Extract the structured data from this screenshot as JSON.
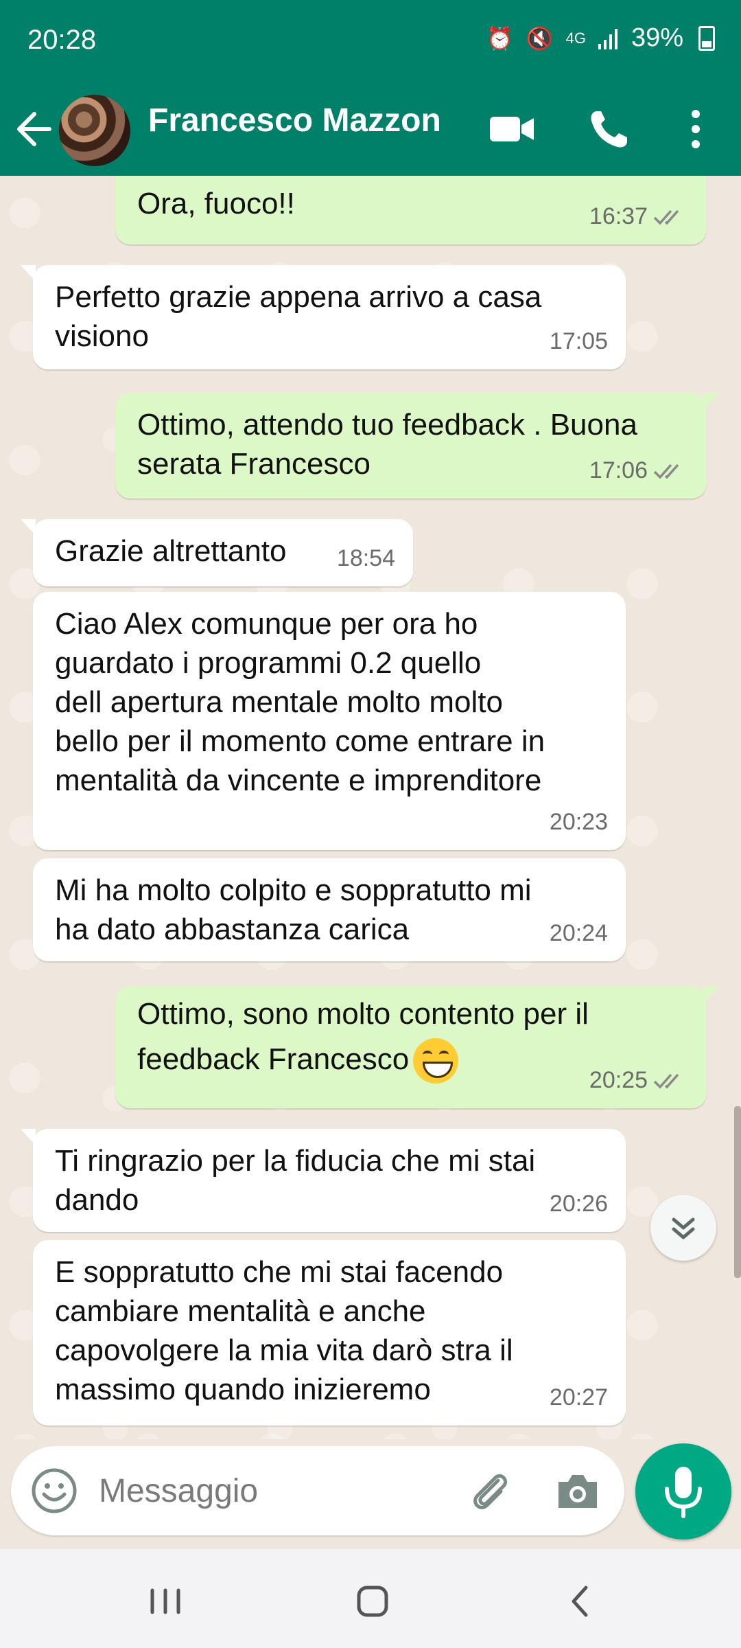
{
  "status_bar": {
    "time": "20:28",
    "network": "4G",
    "battery": "39%"
  },
  "header": {
    "contact_name": "Francesco Mazzon"
  },
  "messages": [
    {
      "text": "Ora, fuoco!!",
      "time": "16:37"
    },
    {
      "text": "Perfetto grazie appena arrivo a casa\nvisiono",
      "time": "17:05"
    },
    {
      "text": "Ottimo, attendo tuo feedback . Buona\nserata Francesco",
      "time": "17:06"
    },
    {
      "text": "Grazie altrettanto",
      "time": "18:54"
    },
    {
      "text": "Ciao Alex comunque per ora ho\nguardato i programmi 0.2 quello\ndell apertura mentale molto molto\nbello per il momento come entrare in\nmentalità da vincente e imprenditore",
      "time": "20:23"
    },
    {
      "text": "Mi ha molto colpito e soppratutto mi\nha dato abbastanza carica",
      "time": "20:24"
    },
    {
      "text": "Ottimo, sono molto contento per il\nfeedback Francesco",
      "time": "20:25"
    },
    {
      "text": "Ti ringrazio per la fiducia che mi stai\ndando",
      "time": "20:26"
    },
    {
      "text": "E soppratutto che mi stai facendo\ncambiare mentalità e anche\ncapovolgere la mia vita darò stra il\nmassimo quando inizieremo",
      "time": "20:27"
    }
  ],
  "composer": {
    "placeholder": "Messaggio"
  },
  "colors": {
    "header": "#008069",
    "outgoing_bubble": "#dcf8c6",
    "incoming_bubble": "#ffffff",
    "mic_button": "#00a884",
    "read_ticks": "#8a8a8a"
  },
  "icons": [
    "back-arrow-icon",
    "video-call-icon",
    "phone-icon",
    "more-vert-icon",
    "emoji-icon",
    "attach-icon",
    "camera-icon",
    "mic-icon",
    "double-chevron-down-icon"
  ]
}
